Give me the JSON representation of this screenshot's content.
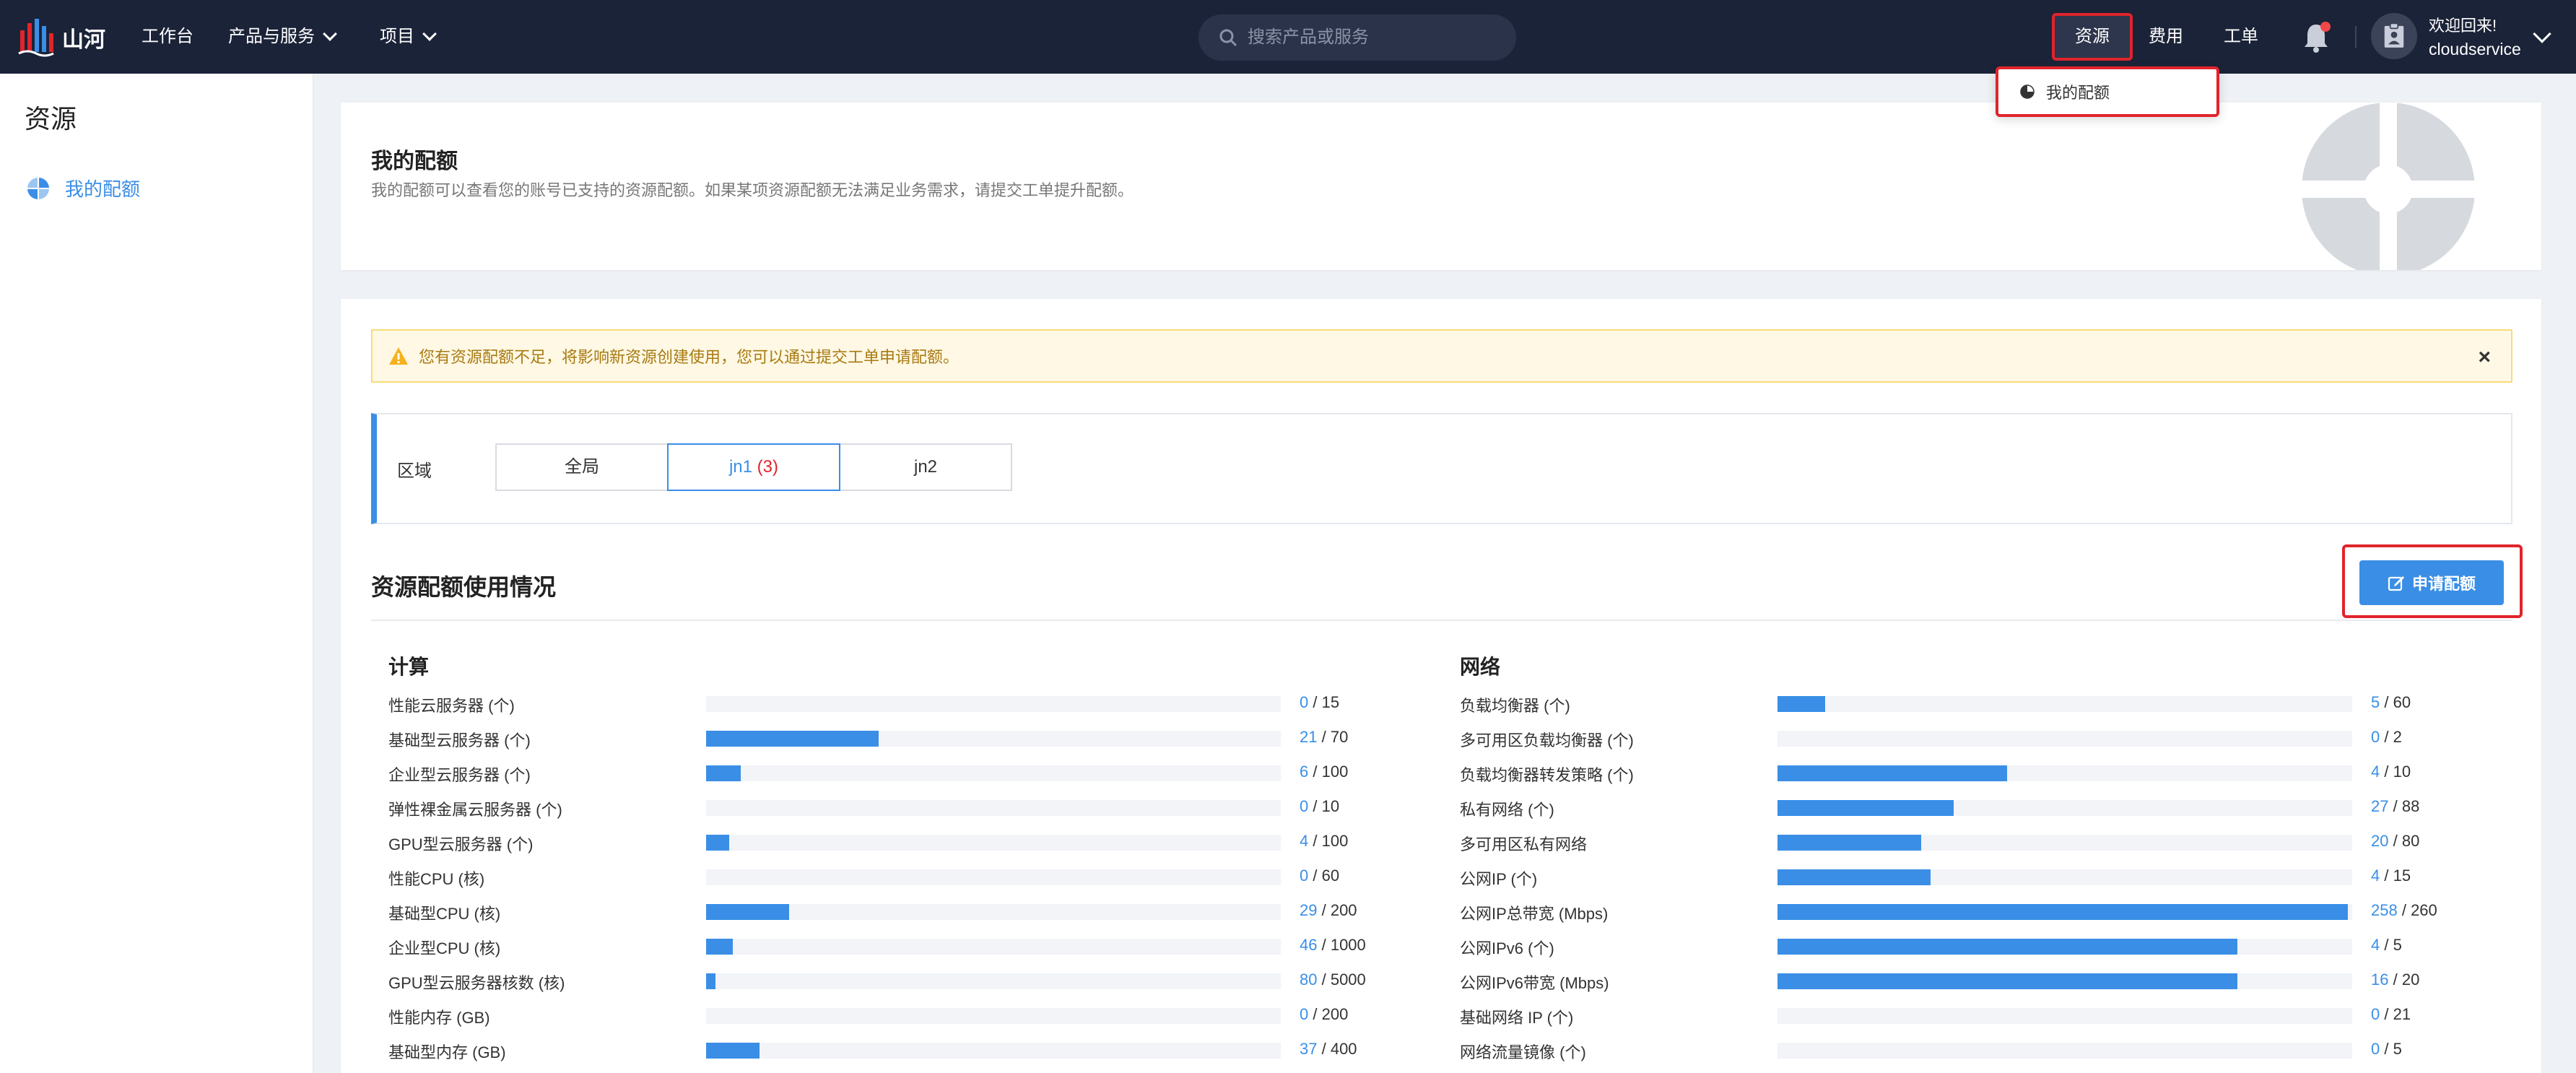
{
  "brand": {
    "name": "山河"
  },
  "nav": {
    "workbench": "工作台",
    "products": "产品与服务",
    "projects": "项目"
  },
  "search": {
    "placeholder": "搜索产品或服务"
  },
  "topbar": {
    "resources": "资源",
    "fees": "费用",
    "tickets": "工单",
    "welcome": "欢迎回来!",
    "username": "cloudservice"
  },
  "dropdown": {
    "my_quota": "我的配额"
  },
  "sidebar": {
    "title": "资源",
    "items": [
      {
        "label": "我的配额",
        "icon": "pie-chart-icon",
        "active": true
      }
    ]
  },
  "header": {
    "title": "我的配额",
    "description": "我的配额可以查看您的账号已支持的资源配额。如果某项资源配额无法满足业务需求，请提交工单提升配额。"
  },
  "alert": {
    "text": "您有资源配额不足，将影响新资源创建使用，您可以通过提交工单申请配额。"
  },
  "region": {
    "label": "区域",
    "tabs": [
      {
        "label": "全局",
        "count": "",
        "active": false
      },
      {
        "label": "jn1",
        "count": "(3)",
        "active": true
      },
      {
        "label": "jn2",
        "count": "",
        "active": false
      }
    ]
  },
  "usage": {
    "title": "资源配额使用情况",
    "apply_button": "申请配额"
  },
  "compute": {
    "title": "计算",
    "rows": [
      {
        "name": "性能云服务器 (个)",
        "used": 0,
        "total": 15
      },
      {
        "name": "基础型云服务器 (个)",
        "used": 21,
        "total": 70
      },
      {
        "name": "企业型云服务器 (个)",
        "used": 6,
        "total": 100
      },
      {
        "name": "弹性裸金属云服务器 (个)",
        "used": 0,
        "total": 10
      },
      {
        "name": "GPU型云服务器 (个)",
        "used": 4,
        "total": 100
      },
      {
        "name": "性能CPU (核)",
        "used": 0,
        "total": 60
      },
      {
        "name": "基础型CPU (核)",
        "used": 29,
        "total": 200
      },
      {
        "name": "企业型CPU (核)",
        "used": 46,
        "total": 1000
      },
      {
        "name": "GPU型云服务器核数 (核)",
        "used": 80,
        "total": 5000
      },
      {
        "name": "性能内存 (GB)",
        "used": 0,
        "total": 200
      },
      {
        "name": "基础型内存 (GB)",
        "used": 37,
        "total": 400
      }
    ]
  },
  "network": {
    "title": "网络",
    "rows": [
      {
        "name": "负载均衡器 (个)",
        "used": 5,
        "total": 60
      },
      {
        "name": "多可用区负载均衡器 (个)",
        "used": 0,
        "total": 2
      },
      {
        "name": "负载均衡器转发策略 (个)",
        "used": 4,
        "total": 10
      },
      {
        "name": "私有网络 (个)",
        "used": 27,
        "total": 88
      },
      {
        "name": "多可用区私有网络",
        "used": 20,
        "total": 80
      },
      {
        "name": "公网IP (个)",
        "used": 4,
        "total": 15
      },
      {
        "name": "公网IP总带宽 (Mbps)",
        "used": 258,
        "total": 260
      },
      {
        "name": "公网IPv6 (个)",
        "used": 4,
        "total": 5
      },
      {
        "name": "公网IPv6带宽 (Mbps)",
        "used": 16,
        "total": 20
      },
      {
        "name": "基础网络 IP (个)",
        "used": 0,
        "total": 21
      },
      {
        "name": "网络流量镜像 (个)",
        "used": 0,
        "total": 5
      }
    ]
  },
  "colors": {
    "topbar": "#1b2338",
    "accent": "#3a8ee6",
    "highlight": "#e0242b",
    "warning_bg": "#fef8e4"
  }
}
